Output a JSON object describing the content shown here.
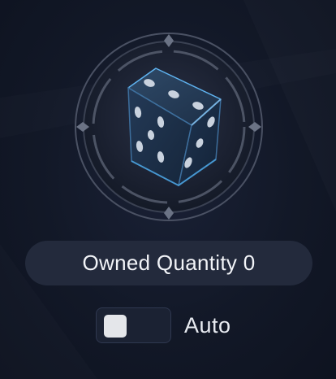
{
  "item": {
    "icon": "dice-icon",
    "owned_label": "Owned Quantity",
    "owned_quantity": "0"
  },
  "auto_toggle": {
    "label": "Auto",
    "checked": false
  },
  "colors": {
    "background": "#121827",
    "pill": "#232a3c",
    "text": "#f2f4f8",
    "dice_accent": "#4aa3e0",
    "toggle_knob": "#e4e6ea"
  }
}
